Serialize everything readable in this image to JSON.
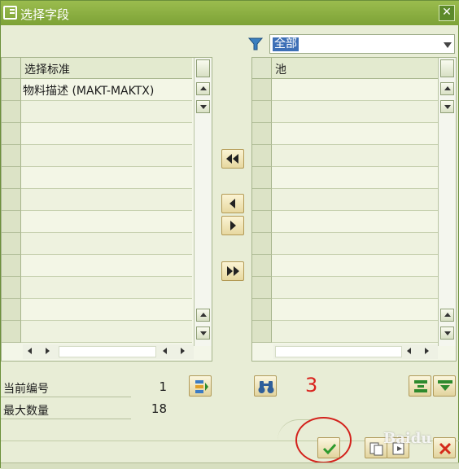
{
  "window": {
    "title": "选择字段",
    "close_glyph": "✕"
  },
  "filter": {
    "selected": "全部",
    "icon": "filter-icon"
  },
  "left_grid": {
    "column_header": "选择标准",
    "rows": [
      "物料描述 (MAKT-MAKTX)",
      "",
      "",
      "",
      "",
      "",
      "",
      "",
      "",
      "",
      "",
      ""
    ]
  },
  "right_grid": {
    "column_header": "池",
    "rows": [
      "",
      "",
      "",
      "",
      "",
      "",
      "",
      "",
      "",
      "",
      "",
      ""
    ]
  },
  "transfer_buttons": [
    "move-all-left",
    "move-one-left",
    "move-one-right",
    "move-all-right"
  ],
  "info": {
    "current_number_label": "当前编号",
    "current_number_value": "1",
    "max_count_label": "最大数量",
    "max_count_value": "18"
  },
  "annotation": {
    "step": "3"
  },
  "watermark": "Baidu",
  "colors": {
    "title_bar": "#8cae42",
    "accent_red": "#d9231e",
    "confirm_green": "#2e9a2e",
    "cancel_red": "#d42a1a"
  }
}
